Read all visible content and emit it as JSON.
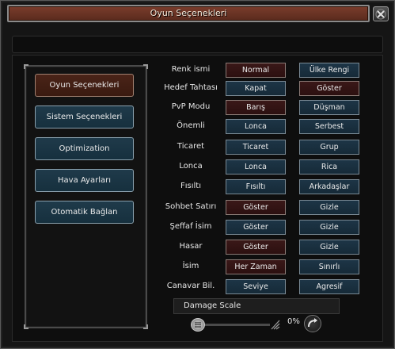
{
  "window": {
    "title": "Oyun Seçenekleri"
  },
  "sidebar": {
    "items": [
      {
        "label": "Oyun Seçenekleri",
        "active": true
      },
      {
        "label": "Sistem Seçenekleri",
        "active": false
      },
      {
        "label": "Optimization",
        "active": false
      },
      {
        "label": "Hava Ayarları",
        "active": false
      },
      {
        "label": "Otomatik Bağlan",
        "active": false
      }
    ]
  },
  "options": [
    {
      "label": "Renk ismi",
      "a": "Normal",
      "b": "Ülke Rengi",
      "selected": "a"
    },
    {
      "label": "Hedef Tahtası",
      "a": "Kapat",
      "b": "Göster",
      "selected": "b"
    },
    {
      "label": "PvP Modu",
      "a": "Barış",
      "b": "Düşman",
      "selected": "a"
    },
    {
      "label": "Önemli",
      "a": "Lonca",
      "b": "Serbest",
      "selected": "none"
    },
    {
      "label": "Ticaret",
      "a": "Ticaret",
      "b": "Grup",
      "selected": "none"
    },
    {
      "label": "Lonca",
      "a": "Lonca",
      "b": "Rica",
      "selected": "none"
    },
    {
      "label": "Fısıltı",
      "a": "Fısıltı",
      "b": "Arkadaşlar",
      "selected": "none"
    },
    {
      "label": "Sohbet Satırı",
      "a": "Göster",
      "b": "Gizle",
      "selected": "a"
    },
    {
      "label": "Şeffaf İsim",
      "a": "Göster",
      "b": "Gizle",
      "selected": "none"
    },
    {
      "label": "Hasar",
      "a": "Göster",
      "b": "Gizle",
      "selected": "a"
    },
    {
      "label": "İsim",
      "a": "Her Zaman",
      "b": "Sınırlı",
      "selected": "a"
    },
    {
      "label": "Canavar Bil.",
      "a": "Seviye",
      "b": "Agresif",
      "selected": "none"
    }
  ],
  "damage_scale": {
    "label": "Damage Scale",
    "value_text": "0%",
    "value": 0
  },
  "colors": {
    "title_bar": "#6a3324",
    "selected": "#3a1818",
    "unselected": "#1d3546"
  },
  "icons": {
    "close": "close-icon",
    "slider": "slider-knob-icon",
    "confirm": "refresh-arrow-icon"
  }
}
